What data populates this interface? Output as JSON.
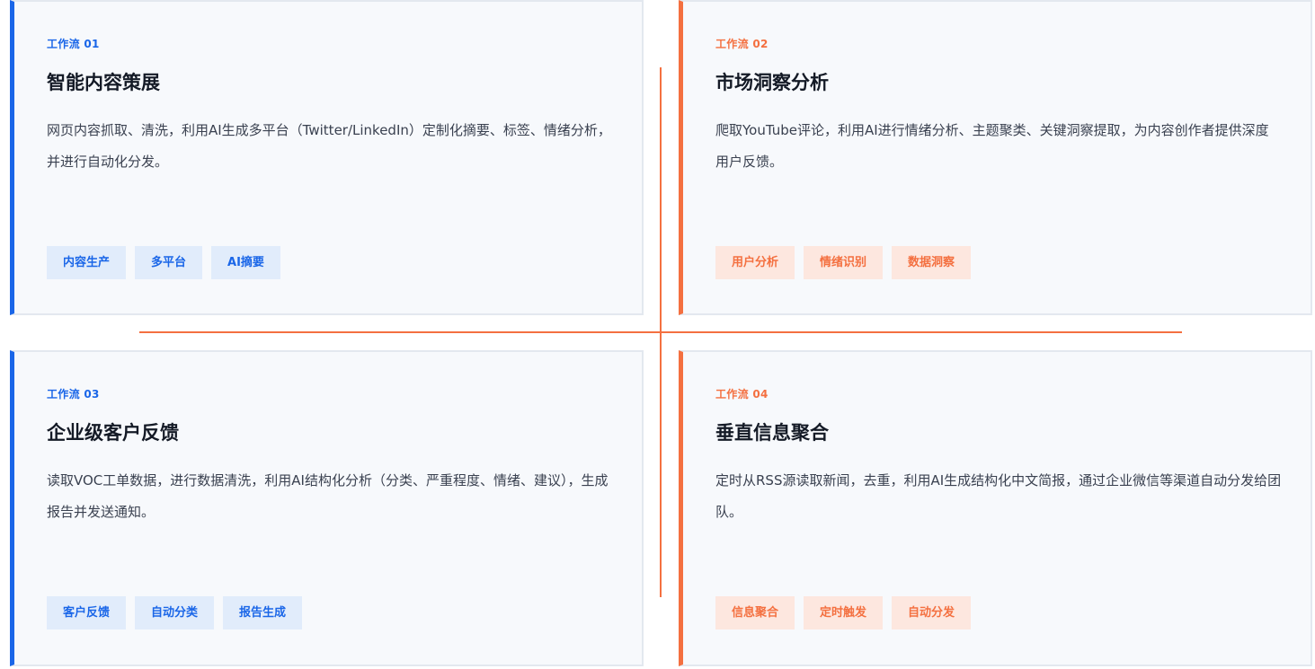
{
  "colors": {
    "blue_accent": "#1a66e8",
    "orange_accent": "#f47040",
    "card_bg": "#f7f9fc"
  },
  "workflows": [
    {
      "label": "工作流 01",
      "title": "智能内容策展",
      "description": "网页内容抓取、清洗，利用AI生成多平台（Twitter/LinkedIn）定制化摘要、标签、情绪分析，并进行自动化分发。",
      "tags": [
        "内容生产",
        "多平台",
        "AI摘要"
      ]
    },
    {
      "label": "工作流 02",
      "title": "市场洞察分析",
      "description": "爬取YouTube评论，利用AI进行情绪分析、主题聚类、关键洞察提取，为内容创作者提供深度用户反馈。",
      "tags": [
        "用户分析",
        "情绪识别",
        "数据洞察"
      ]
    },
    {
      "label": "工作流 03",
      "title": "企业级客户反馈",
      "description": "读取VOC工单数据，进行数据清洗，利用AI结构化分析（分类、严重程度、情绪、建议），生成报告并发送通知。",
      "tags": [
        "客户反馈",
        "自动分类",
        "报告生成"
      ]
    },
    {
      "label": "工作流 04",
      "title": "垂直信息聚合",
      "description": "定时从RSS源读取新闻，去重，利用AI生成结构化中文简报，通过企业微信等渠道自动分发给团队。",
      "tags": [
        "信息聚合",
        "定时触发",
        "自动分发"
      ]
    }
  ]
}
